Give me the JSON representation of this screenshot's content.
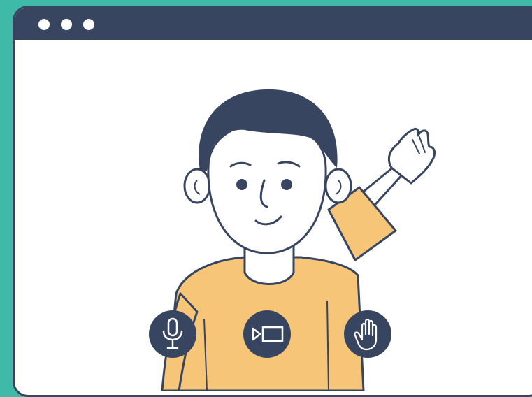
{
  "window": {
    "titlebar_dots": [
      "close",
      "minimize",
      "maximize"
    ]
  },
  "colors": {
    "background": "#3fbaa8",
    "window_frame": "#374560",
    "window_body": "#ffffff",
    "shirt": "#f7c577",
    "hair": "#374560",
    "skin": "#ffffff"
  },
  "controls": [
    {
      "icon": "microphone-icon",
      "action": "toggle-microphone"
    },
    {
      "icon": "video-camera-icon",
      "action": "toggle-camera"
    },
    {
      "icon": "raise-hand-icon",
      "action": "raise-hand"
    }
  ]
}
